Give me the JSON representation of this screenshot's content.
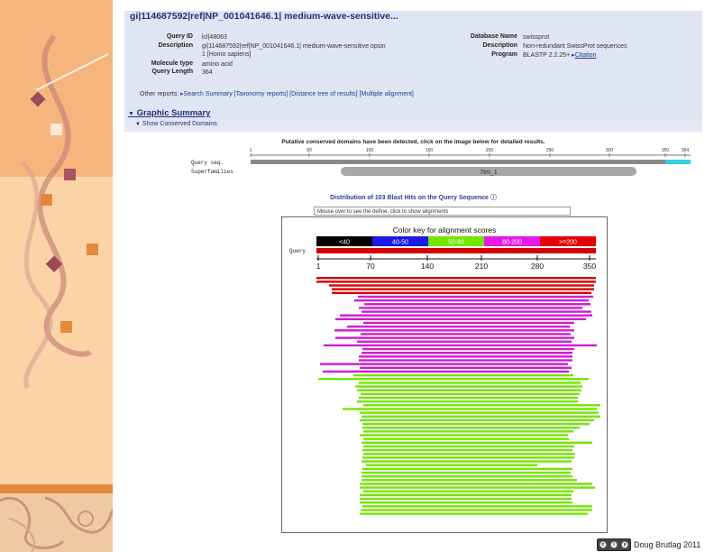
{
  "title": "gi|114687592|ref|NP_001041646.1| medium-wave-sensitive...",
  "query_info": {
    "query_id_label": "Query ID",
    "query_id": "lcl|48063",
    "description_label": "Description",
    "description_line1": "gi|114687592|ref|NP_001041646.1| medium-wave-sensitive opsin",
    "description_line2": "1 [Homo sapiens]",
    "molecule_type_label": "Molecule type",
    "molecule_type": "amino acid",
    "query_length_label": "Query Length",
    "query_length": "364"
  },
  "db_info": {
    "database_label": "Database Name",
    "database": "swissprot",
    "description_label": "Description",
    "description": "Non-redundant SwissProt sequences",
    "program_label": "Program",
    "program": "BLASTP 2.2.25+",
    "citation": "Citation"
  },
  "other_reports": {
    "label": "Other reports:",
    "links": "Search Summary [Taxonomy reports] [Distance tree of results] [Multiple alignment]"
  },
  "graphic_summary": "Graphic Summary",
  "show_cdd": "Show Conserved Domains",
  "putative_text": "Putative conserved domains have been detected, click on the image below for detailed results.",
  "cd": {
    "ticks": [
      "1",
      "50",
      "100",
      "150",
      "200",
      "250",
      "300",
      "350",
      "364"
    ],
    "query_seq_label": "Query seq.",
    "superfamilies_label": "Superfamilies",
    "domain_label": "7tm_1"
  },
  "dist_title": "Distribution of 103 Blast Hits on the Query Sequence",
  "mouse_over_text": "Mouse over to see the define, click to show alignments",
  "color_key": {
    "title": "Color key for alignment scores",
    "items": [
      {
        "label": "<40",
        "color": "#000000"
      },
      {
        "label": "40-50",
        "color": "#1a1ae6"
      },
      {
        "label": "50-80",
        "color": "#73e600"
      },
      {
        "label": "80-200",
        "color": "#e61ae6"
      },
      {
        "label": ">=200",
        "color": "#e60000"
      }
    ]
  },
  "query_label": "Query",
  "scale_ticks": [
    "1",
    "70",
    "140",
    "210",
    "280",
    "350"
  ],
  "footer": "Doug Brutlag 2011",
  "hits_colors": {
    "red": "#d40000",
    "magenta": "#d21ad8",
    "green": "#73e600"
  }
}
